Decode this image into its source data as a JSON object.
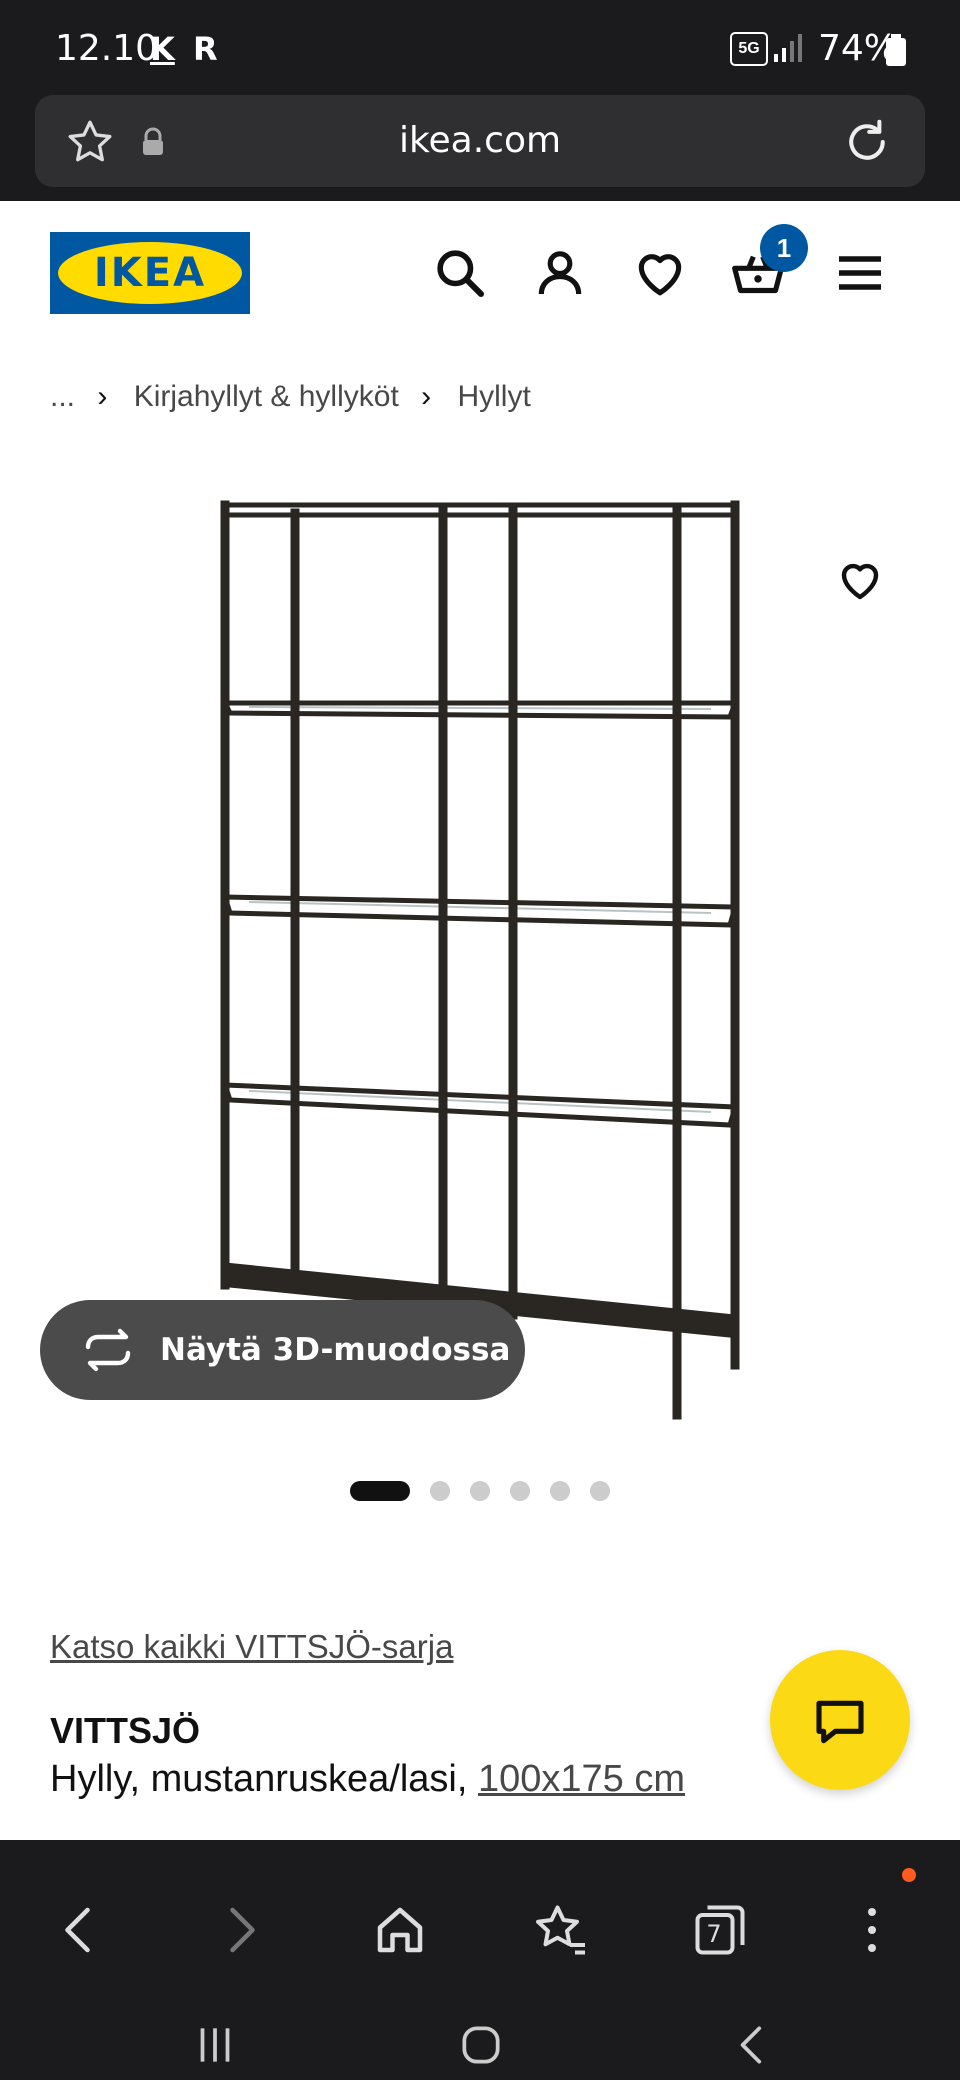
{
  "status_bar": {
    "time": "12.10",
    "icon_k": "K",
    "icon_r": "R",
    "network": "5G",
    "battery": "74%"
  },
  "browser": {
    "url": "ikea.com",
    "tab_count": "7"
  },
  "header": {
    "logo_text": "IKEA",
    "cart_count": "1"
  },
  "breadcrumb": {
    "ellipsis": "...",
    "items": [
      "Kirjahyllyt & hyllyköt",
      "Hyllyt"
    ]
  },
  "gallery": {
    "view_3d_label": "Näytä 3D-muodossa",
    "dot_count": 6,
    "active_index": 0
  },
  "product": {
    "series_link": "Katso kaikki VITTSJÖ-sarja",
    "name": "VITTSJÖ",
    "description": "Hylly, mustanruskea/lasi,",
    "size_link": "100x175 cm"
  },
  "colors": {
    "ikea_blue": "#0058a3",
    "ikea_yellow": "#ffdb00",
    "chat_yellow": "#fbd914",
    "browser_dark": "#1b1b1d"
  }
}
